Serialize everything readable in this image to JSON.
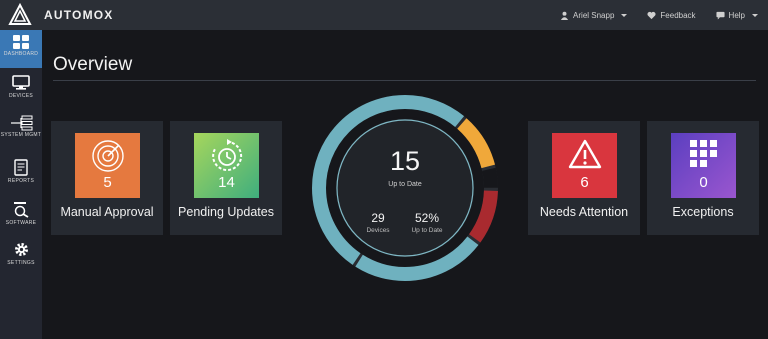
{
  "app": {
    "name": "AUTOMOX",
    "user": "Ariel Snapp",
    "feedback": "Feedback",
    "help": "Help"
  },
  "sidebar": {
    "items": [
      {
        "label": "DASHBOARD",
        "icon": "dashboard-grid-icon",
        "active": true
      },
      {
        "label": "DEVICES",
        "icon": "monitor-icon",
        "active": false
      },
      {
        "label": "SYSTEM MGMT",
        "icon": "system-tree-icon",
        "active": false
      },
      {
        "label": "REPORTS",
        "icon": "report-icon",
        "active": false
      },
      {
        "label": "SOFTWARE",
        "icon": "software-icon",
        "active": false
      },
      {
        "label": "SETTINGS",
        "icon": "gear-icon",
        "active": false
      }
    ]
  },
  "page": {
    "title": "Overview"
  },
  "cards": [
    {
      "label": "Manual Approval",
      "count": "5",
      "icon": "radar-icon",
      "color": "#e5793f"
    },
    {
      "label": "Pending Updates",
      "count": "14",
      "icon": "timer-icon",
      "color": "#6cc06a"
    },
    {
      "label": "Needs Attention",
      "count": "6",
      "icon": "warning-icon",
      "color": "#d9363e"
    },
    {
      "label": "Exceptions",
      "count": "0",
      "icon": "keypad-icon",
      "color": "#7c4fc8"
    }
  ],
  "summary": {
    "up_to_date_count": "15",
    "up_to_date_label": "Up to Date",
    "devices_count": "29",
    "devices_label": "Devices",
    "percent": "52%",
    "percent_label": "Up to Date",
    "segments": [
      {
        "name": "up-to-date",
        "color": "#6fb1bf",
        "fraction": 0.52
      },
      {
        "name": "pending",
        "color": "#f0a83a",
        "fraction": 0.1
      },
      {
        "name": "gap-a",
        "color": "#16171b",
        "fraction": 0.04
      },
      {
        "name": "attention",
        "color": "#a92a2f",
        "fraction": 0.1
      }
    ]
  }
}
